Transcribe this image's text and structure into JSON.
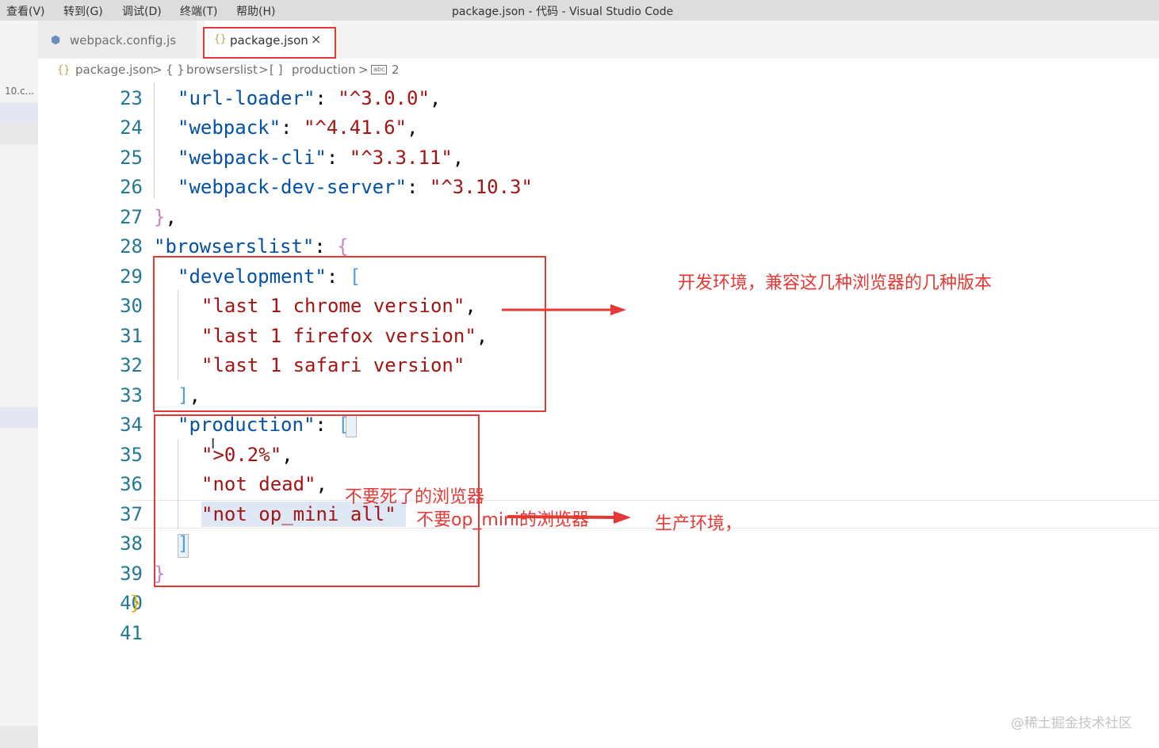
{
  "menubar": {
    "items": [
      "查看(V)",
      "转到(G)",
      "调试(D)",
      "终端(T)",
      "帮助(H)"
    ],
    "title": "package.json - 代码 - Visual Studio Code"
  },
  "sidebar": {
    "file_label": "10.c..."
  },
  "tabs": [
    {
      "label": "webpack.config.js",
      "icon": "webpack-cube-icon"
    },
    {
      "label": "package.json",
      "icon": "json-braces-icon",
      "close": "×"
    }
  ],
  "breadcrumb": {
    "file_icon": "{}",
    "file": "package.json",
    "sep": ">",
    "obj_icon": "{ }",
    "object": "browserslist",
    "arr_icon": "[ ]",
    "array": "production",
    "str_icon": "abc",
    "index": "2"
  },
  "editor": {
    "line_numbers": [
      "23",
      "24",
      "25",
      "26",
      "27",
      "28",
      "29",
      "30",
      "31",
      "32",
      "33",
      "34",
      "35",
      "36",
      "37",
      "38",
      "39",
      "40",
      "41"
    ],
    "lines": {
      "l23": {
        "key": "\"url-loader\"",
        "colon": ": ",
        "value": "\"^3.0.0\"",
        "tail": ","
      },
      "l24": {
        "key": "\"webpack\"",
        "colon": ": ",
        "value": "\"^4.41.6\"",
        "tail": ","
      },
      "l25": {
        "key": "\"webpack-cli\"",
        "colon": ": ",
        "value": "\"^3.3.11\"",
        "tail": ","
      },
      "l26": {
        "key": "\"webpack-dev-server\"",
        "colon": ": ",
        "value": "\"^3.10.3\""
      },
      "l27": {
        "brace": "}",
        "tail": ","
      },
      "l28": {
        "key": "\"browserslist\"",
        "colon": ": ",
        "brace": "{"
      },
      "l29": {
        "key": "\"development\"",
        "colon": ": ",
        "bracket": "["
      },
      "l30": {
        "value": "\"last 1 chrome version\"",
        "tail": ","
      },
      "l31": {
        "value": "\"last 1 firefox version\"",
        "tail": ","
      },
      "l32": {
        "value": "\"last 1 safari version\""
      },
      "l33": {
        "bracket": "]",
        "tail": ","
      },
      "l34": {
        "key": "\"production\"",
        "colon": ": ",
        "bracket": "["
      },
      "l35": {
        "value": "\">0.2%\"",
        "tail": ","
      },
      "l36": {
        "value": "\"not dead\"",
        "tail": ","
      },
      "l37": {
        "value": "\"not op_mini all\""
      },
      "l38": {
        "bracket": "]"
      },
      "l39": {
        "brace": "}"
      },
      "l40": {
        "brace": "}"
      }
    }
  },
  "annotations": {
    "dev_note": "开发环境，兼容这几种浏览器的几种版本",
    "dead_note": "不要死了的浏览器",
    "opmini_note": "不要op_mini的浏览器",
    "prod_note": "生产环境，"
  },
  "colors": {
    "annotation": "#e53935",
    "string": "#a31515",
    "key": "#0451a5",
    "line_number": "#237893"
  },
  "watermark": "@稀土掘金技术社区"
}
